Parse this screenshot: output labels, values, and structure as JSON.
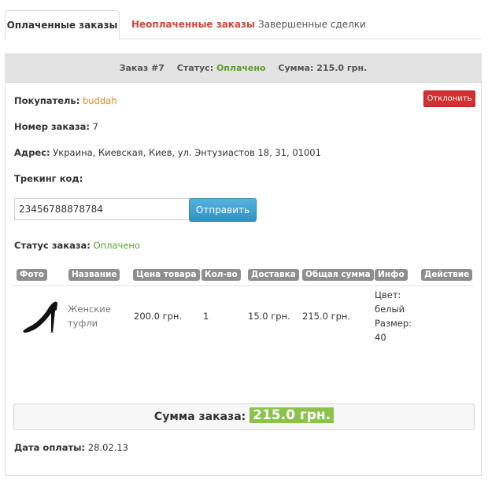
{
  "tabs": [
    {
      "label": "Оплаченные заказы"
    },
    {
      "label": "Неоплаченные заказы"
    },
    {
      "label": "Завершенные сделки"
    }
  ],
  "order_header": {
    "order_label": "Заказ #7",
    "status_label": "Статус:",
    "status_value": "Оплачено",
    "sum_label": "Сумма: 215.0 грн."
  },
  "buyer": {
    "label": "Покупатель:",
    "value": "buddah"
  },
  "reject_button": "Отклонить",
  "order_number": {
    "label": "Номер заказа:",
    "value": "7"
  },
  "address": {
    "label": "Адрес:",
    "value": "Украина, Киевская, Киев, ул. Энтузиастов 18, 31, 01001"
  },
  "tracking": {
    "label": "Трекинг код:",
    "value": "23456788878784",
    "send_label": "Отправить"
  },
  "order_status": {
    "label": "Статус заказа:",
    "value": "Оплачено"
  },
  "table": {
    "headers": [
      "Фото",
      "Название",
      "Цена товара",
      "Кол-во",
      "Доставка",
      "Общая сумма",
      "Инфо",
      "Действие"
    ],
    "row": {
      "name_line1": "Женские",
      "name_line2": "туфли",
      "price": "200.0 грн.",
      "qty": "1",
      "delivery": "15.0 грн.",
      "total": "215.0 грн.",
      "info": [
        "Цвет:",
        "белый",
        "Размер:",
        "40"
      ]
    }
  },
  "order_total": {
    "label": "Сумма заказа:",
    "value": "215.0 грн."
  },
  "payment_date": {
    "label": "Дата оплаты:",
    "value": "28.02.13"
  }
}
